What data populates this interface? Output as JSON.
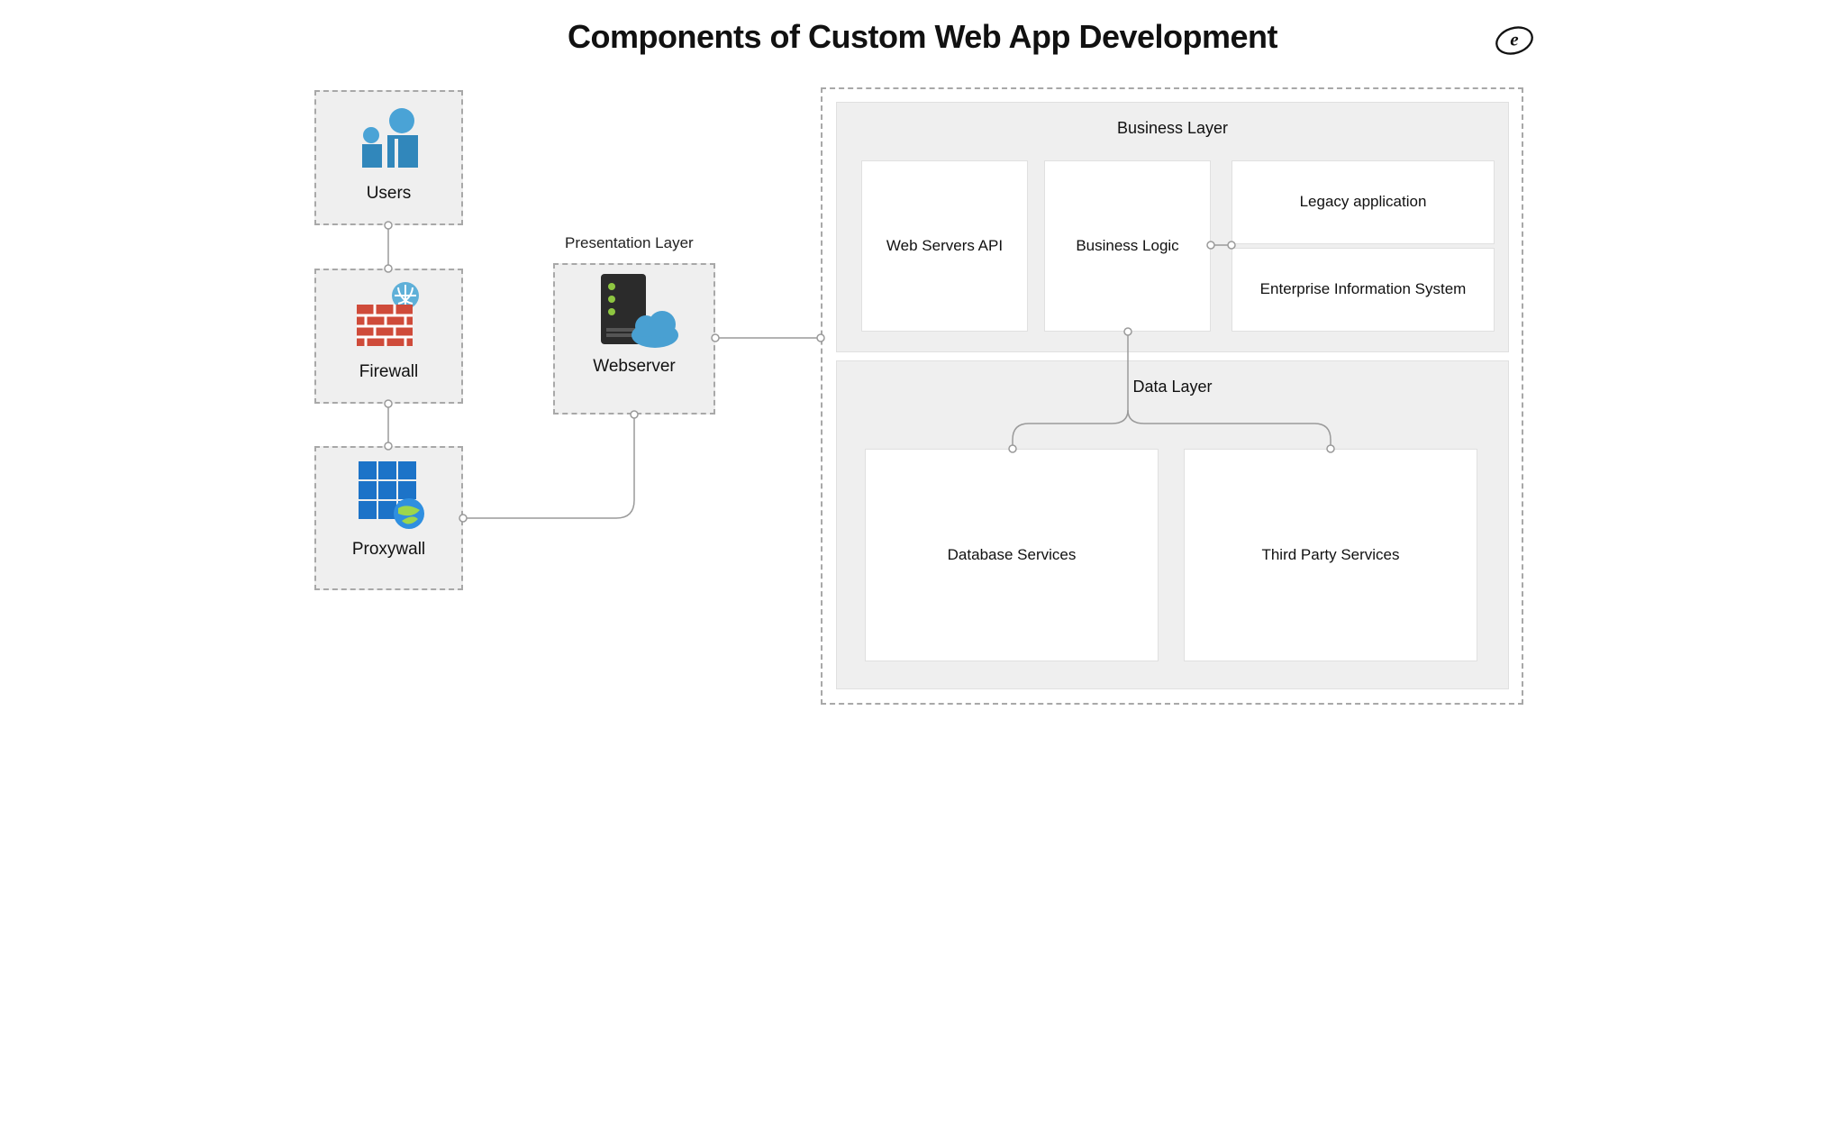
{
  "title": "Components of Custom Web App Development",
  "nodes": {
    "users": "Users",
    "firewall": "Firewall",
    "proxywall": "Proxywall",
    "webserver": "Webserver"
  },
  "presentation_label": "Presentation Layer",
  "business_layer": {
    "title": "Business Layer",
    "web_servers_api": "Web Servers API",
    "business_logic": "Business Logic",
    "legacy_app": "Legacy application",
    "eis": "Enterprise Information System"
  },
  "data_layer": {
    "title": "Data Layer",
    "database_services": "Database Services",
    "third_party_services": "Third Party Services"
  }
}
